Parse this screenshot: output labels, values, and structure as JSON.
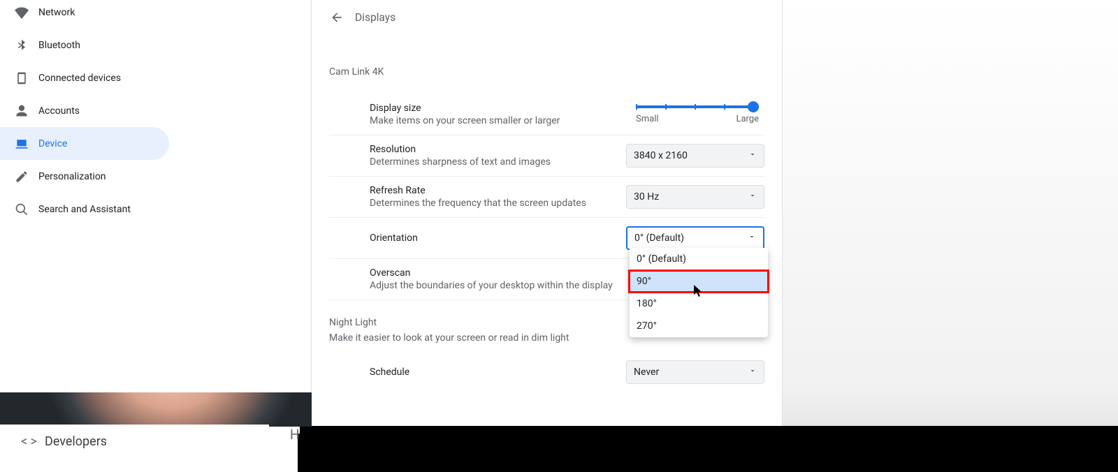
{
  "sidebar": {
    "items": [
      {
        "label": "Network"
      },
      {
        "label": "Bluetooth"
      },
      {
        "label": "Connected devices"
      },
      {
        "label": "Accounts"
      },
      {
        "label": "Device"
      },
      {
        "label": "Personalization"
      },
      {
        "label": "Search and Assistant"
      }
    ]
  },
  "header": {
    "title": "Displays"
  },
  "display_name": "Cam Link 4K",
  "rows": {
    "display_size": {
      "title": "Display size",
      "sub": "Make items on your screen smaller or larger",
      "small_label": "Small",
      "large_label": "Large"
    },
    "resolution": {
      "title": "Resolution",
      "sub": "Determines sharpness of text and images",
      "value": "3840 x 2160"
    },
    "refresh": {
      "title": "Refresh Rate",
      "sub": "Determines the frequency that the screen updates",
      "value": "30 Hz"
    },
    "orientation": {
      "title": "Orientation",
      "value": "0° (Default)",
      "options": [
        "0° (Default)",
        "90°",
        "180°",
        "270°"
      ]
    },
    "overscan": {
      "title": "Overscan",
      "sub": "Adjust the boundaries of your desktop within the display"
    },
    "schedule": {
      "title": "Schedule",
      "value": "Never"
    }
  },
  "night_light": {
    "title": "Night Light",
    "sub": "Make it easier to look at your screen or read in dim light"
  },
  "developers_label": "Developers",
  "float_h": "H"
}
